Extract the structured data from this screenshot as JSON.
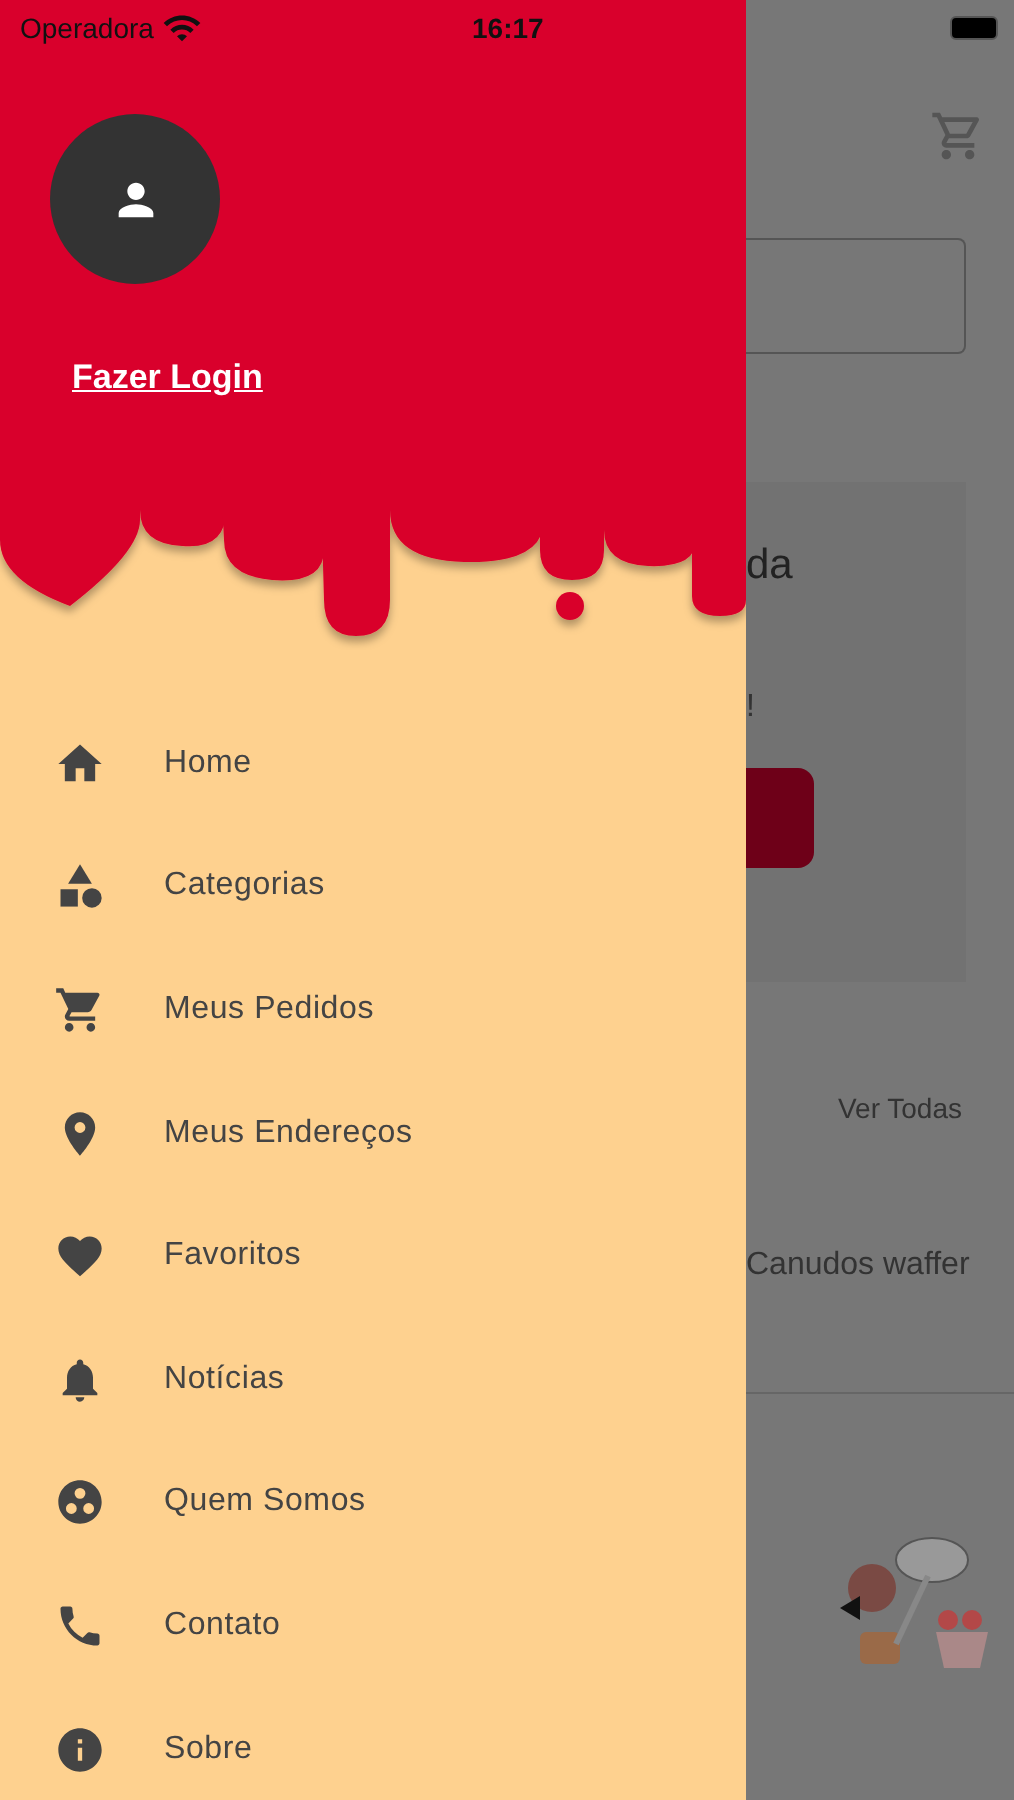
{
  "status_bar": {
    "carrier": "Operadora",
    "time": "16:17"
  },
  "drawer": {
    "login_link": "Fazer Login",
    "menu": [
      {
        "label": "Home"
      },
      {
        "label": "Categorias"
      },
      {
        "label": "Meus Pedidos"
      },
      {
        "label": "Meus Endereços"
      },
      {
        "label": "Favoritos"
      },
      {
        "label": "Notícias"
      },
      {
        "label": "Quem Somos"
      },
      {
        "label": "Contato"
      },
      {
        "label": "Sobre"
      }
    ]
  },
  "background_page": {
    "title_fragment": "da",
    "text_fragment": "!",
    "see_all_link": "Ver Todas",
    "product_name": "Canudos waffer"
  }
}
